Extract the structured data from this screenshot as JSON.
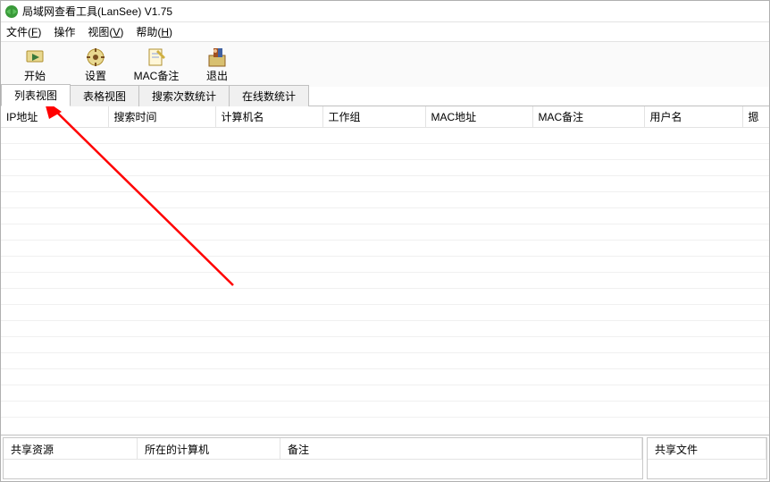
{
  "title": "局域网查看工具(LanSee) V1.75",
  "menu": {
    "file": "文件(F)",
    "operate": "操作",
    "view": "视图(V)",
    "help": "帮助(H)"
  },
  "toolbar": {
    "start": "开始",
    "settings": "设置",
    "mac_note": "MAC备注",
    "exit": "退出"
  },
  "tabs": {
    "list": "列表视图",
    "table": "表格视图",
    "search_stats": "搜索次数统计",
    "online_stats": "在线数统计"
  },
  "grid_headers": {
    "ip": "IP地址",
    "search_time": "搜索时间",
    "computer": "计算机名",
    "workgroup": "工作组",
    "mac": "MAC地址",
    "mac_note": "MAC备注",
    "username": "用户名",
    "more": "摁"
  },
  "bottom": {
    "share_resource": "共享资源",
    "host_computer": "所在的计算机",
    "remark": "备注",
    "share_file": "共享文件"
  }
}
